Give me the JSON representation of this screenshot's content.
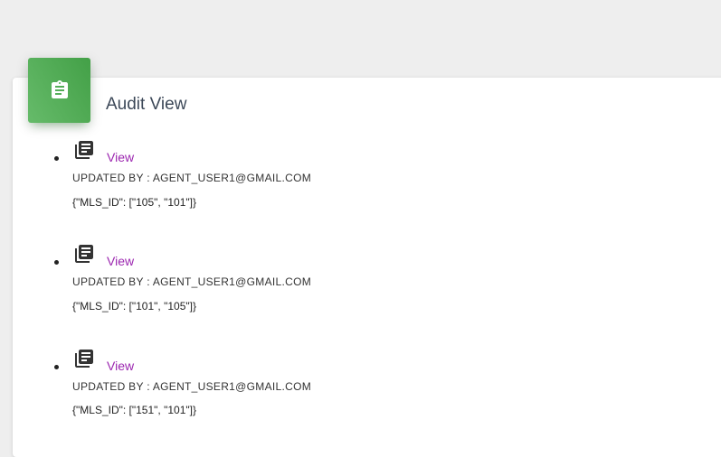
{
  "card": {
    "title": "Audit View",
    "header_icon": "clipboard-icon",
    "accent_color": "#4caf50"
  },
  "audit_entries": [
    {
      "icon": "library-books-icon",
      "link_label": "View",
      "updated_by_label": "UPDATED BY :",
      "updated_by_value": "AGENT_USER1@GMAIL.COM",
      "payload": "{\"MLS_ID\": [\"105\", \"101\"]}"
    },
    {
      "icon": "library-books-icon",
      "link_label": "View",
      "updated_by_label": "UPDATED BY :",
      "updated_by_value": "AGENT_USER1@GMAIL.COM",
      "payload": "{\"MLS_ID\": [\"101\", \"105\"]}"
    },
    {
      "icon": "library-books-icon",
      "link_label": "View",
      "updated_by_label": "UPDATED BY :",
      "updated_by_value": "AGENT_USER1@GMAIL.COM",
      "payload": "{\"MLS_ID\": [\"151\", \"101\"]}"
    }
  ],
  "link_color": "#9c27b0"
}
